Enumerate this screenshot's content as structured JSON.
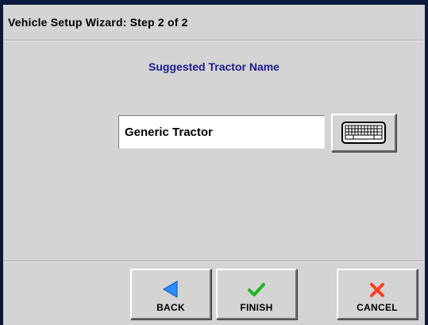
{
  "window": {
    "title": "Vehicle Setup Wizard:  Step 2 of 2"
  },
  "main": {
    "heading": "Suggested Tractor Name",
    "tractor_name": {
      "value": "Generic Tractor"
    },
    "keyboard_icon": "keyboard-icon"
  },
  "footer": {
    "back_label": "BACK",
    "finish_label": "FINISH",
    "cancel_label": "CANCEL",
    "icons": {
      "back": "arrow-left-icon",
      "finish": "checkmark-icon",
      "cancel": "x-icon"
    }
  },
  "colors": {
    "background": "#0b1a3c",
    "panel": "#d4d4d4",
    "heading": "#1b1b8f",
    "back_arrow": "#2a8cff",
    "finish_check": "#22b322",
    "cancel_x": "#ff3b1f"
  }
}
